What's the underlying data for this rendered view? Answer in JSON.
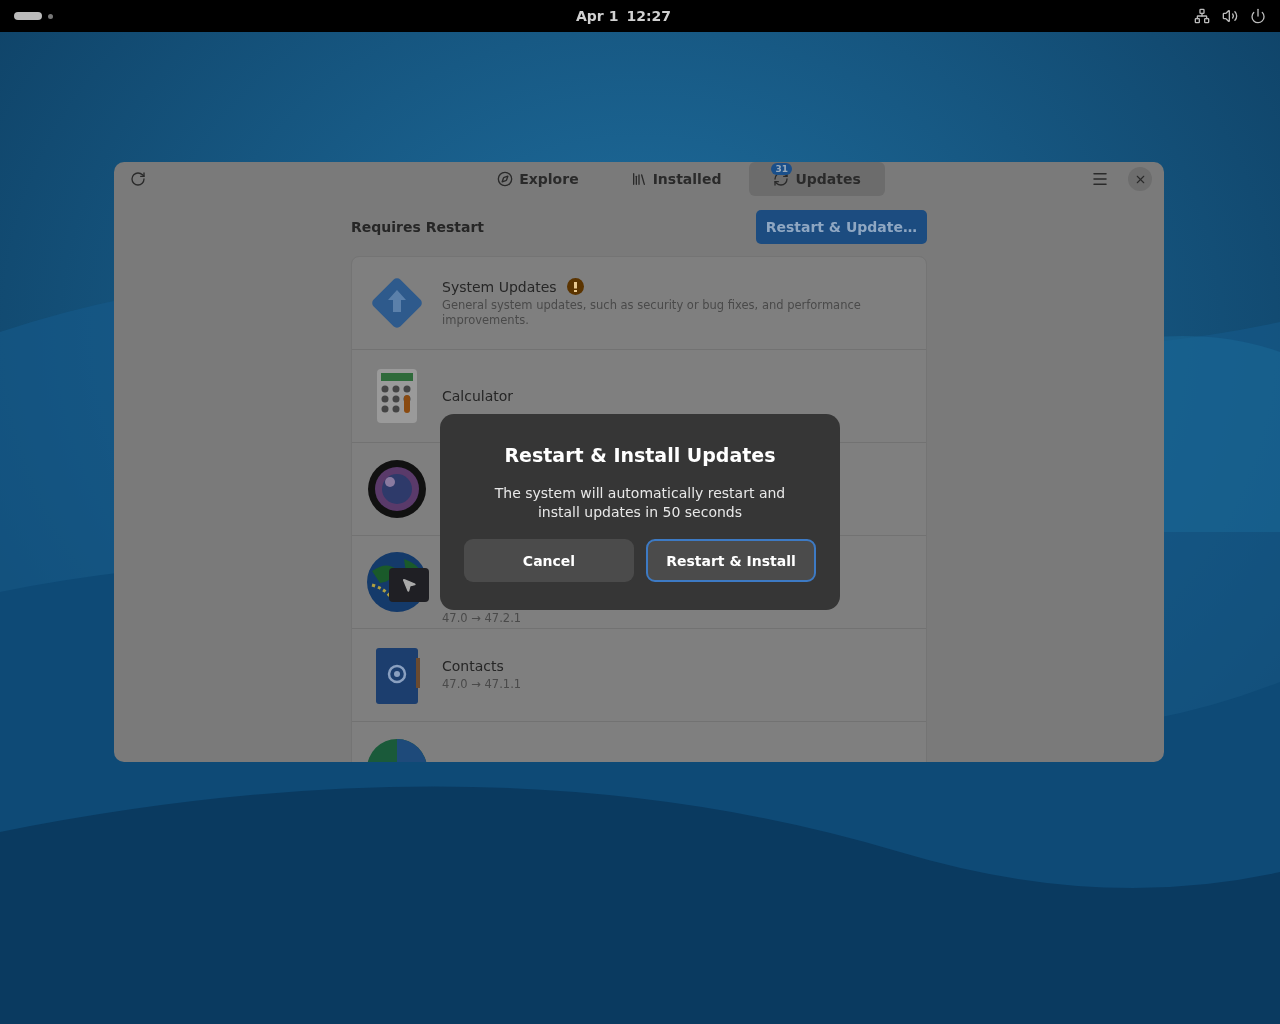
{
  "top_bar": {
    "date": "Apr 1",
    "time": "12:27"
  },
  "window": {
    "tabs": [
      {
        "label": "Explore",
        "selected": false
      },
      {
        "label": "Installed",
        "selected": false
      },
      {
        "label": "Updates",
        "selected": true,
        "badge": "31"
      }
    ],
    "section_title": "Requires Restart",
    "primary_button": "Restart & Update…",
    "rows": [
      {
        "kind": "system",
        "name": "System Updates",
        "warning": true,
        "description": "General system updates, such as security or bug fixes, and performance improvements."
      },
      {
        "kind": "calculator",
        "name": "Calculator"
      },
      {
        "kind": "camera"
      },
      {
        "kind": "maps",
        "version": "47.0 → 47.2.1"
      },
      {
        "kind": "contacts",
        "name": "Contacts",
        "version": "47.0 → 47.1.1"
      },
      {
        "kind": "globe"
      }
    ]
  },
  "dialog": {
    "title": "Restart & Install Updates",
    "message": "The system will automatically restart and install updates in 50 seconds",
    "buttons": [
      {
        "label": "Cancel",
        "kind": "secondary"
      },
      {
        "label": "Restart & Install",
        "kind": "suggested"
      }
    ]
  }
}
